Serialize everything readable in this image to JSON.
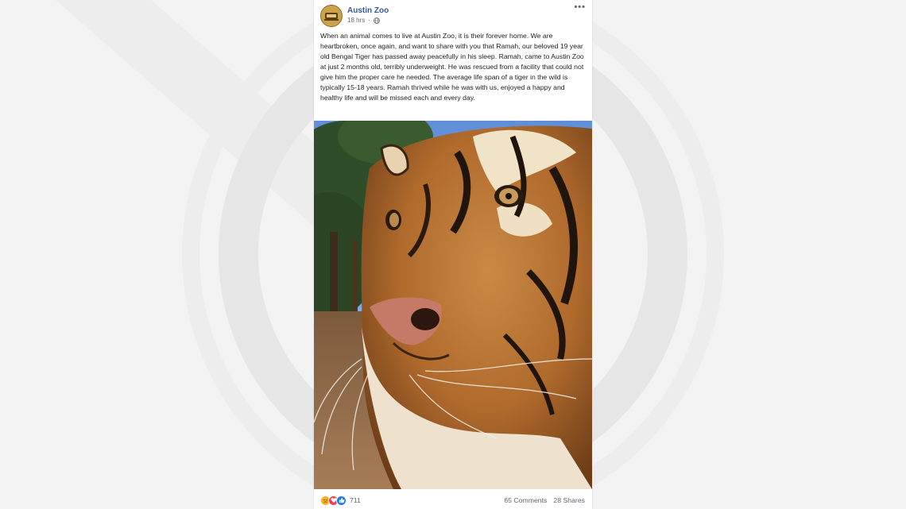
{
  "post": {
    "page_name": "Austin Zoo",
    "time": "18 hrs",
    "body": "When an animal comes to live at Austin Zoo, it is their forever home. We are heartbroken, once again, and want to share with you that Ramah, our beloved 19 year old Bengal Tiger has passed away peacefully in his sleep. Ramah, came to Austin Zoo at just 2 months old, terribly underweight. He was rescued from a facility that could not give him the proper care he needed. The average life span of a tiger in the wild is typically 15-18 years. Ramah thrived while he was with us, enjoyed a happy and healthy life and will be missed each and every day.",
    "more_icon": "•••",
    "privacy_icon": "globe-icon",
    "image_subject": "tiger-photo"
  },
  "footer": {
    "reaction_icons": [
      "sad-reaction-icon",
      "love-reaction-icon",
      "like-reaction-icon"
    ],
    "reaction_count": "711",
    "comments": "65 Comments",
    "shares": "28 Shares"
  },
  "colors": {
    "page_name": "#385898",
    "background": "#f3f3f3",
    "text": "#1c1e21",
    "meta": "#616770"
  }
}
